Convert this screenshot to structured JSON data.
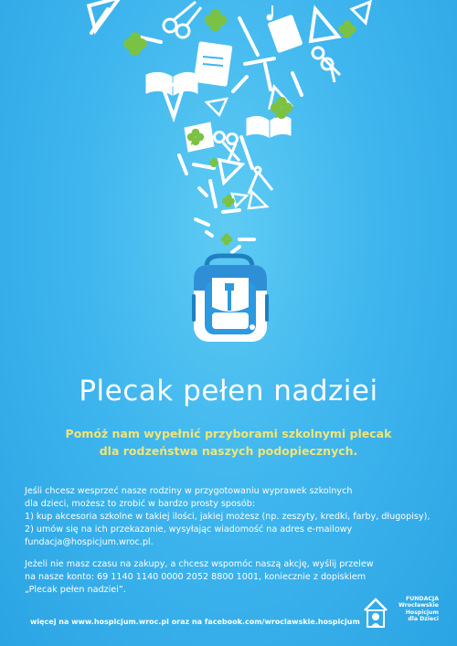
{
  "poster": {
    "title": "Plecak pełen nadziei",
    "subtitle": {
      "line1": "Pomóż nam wypełnić przyborami szkolnymi plecak",
      "line2": "dla rodzeństwa naszych podopiecznych."
    },
    "paragraph1": {
      "line1": "Jeśli chcesz wesprzeć nasze rodziny w przygotowaniu wyprawek szkolnych",
      "line2": "dla dzieci, możesz to zrobić w bardzo prosty sposób:",
      "line3": "1) kup akcesoria szkolne w takiej ilości, jakiej możesz (np. zeszyty, kredki, farby, długopisy),",
      "line4": "2) umów się na ich przekazanie, wysyłając wiadomość na adres e-mailowy",
      "line5": "fundacja@hospicjum.wroc.pl."
    },
    "paragraph2": {
      "line1": "Jeżeli nie masz czasu na zakupy, a chcesz wspomóc naszą akcję, wyślij przelew",
      "line2": "na nasze konto: 69 1140 1140 0000 2052 8800 1001, koniecznie z dopiskiem",
      "line3": "„Plecak pełen nadziei”."
    },
    "footer_web": "więcej na www.hospicjum.wroc.pl oraz na facebook.com/wroclawskie.hospicjum",
    "logo": {
      "line1": "FUNDACJA",
      "line2": "Wrocławskie",
      "line3": "Hospicjum",
      "line4": "dla Dzieci"
    },
    "colors": {
      "background": "#3fb6ee",
      "subtitle": "#f1e476",
      "clover": "#7cc242",
      "text": "#ffffff"
    }
  }
}
